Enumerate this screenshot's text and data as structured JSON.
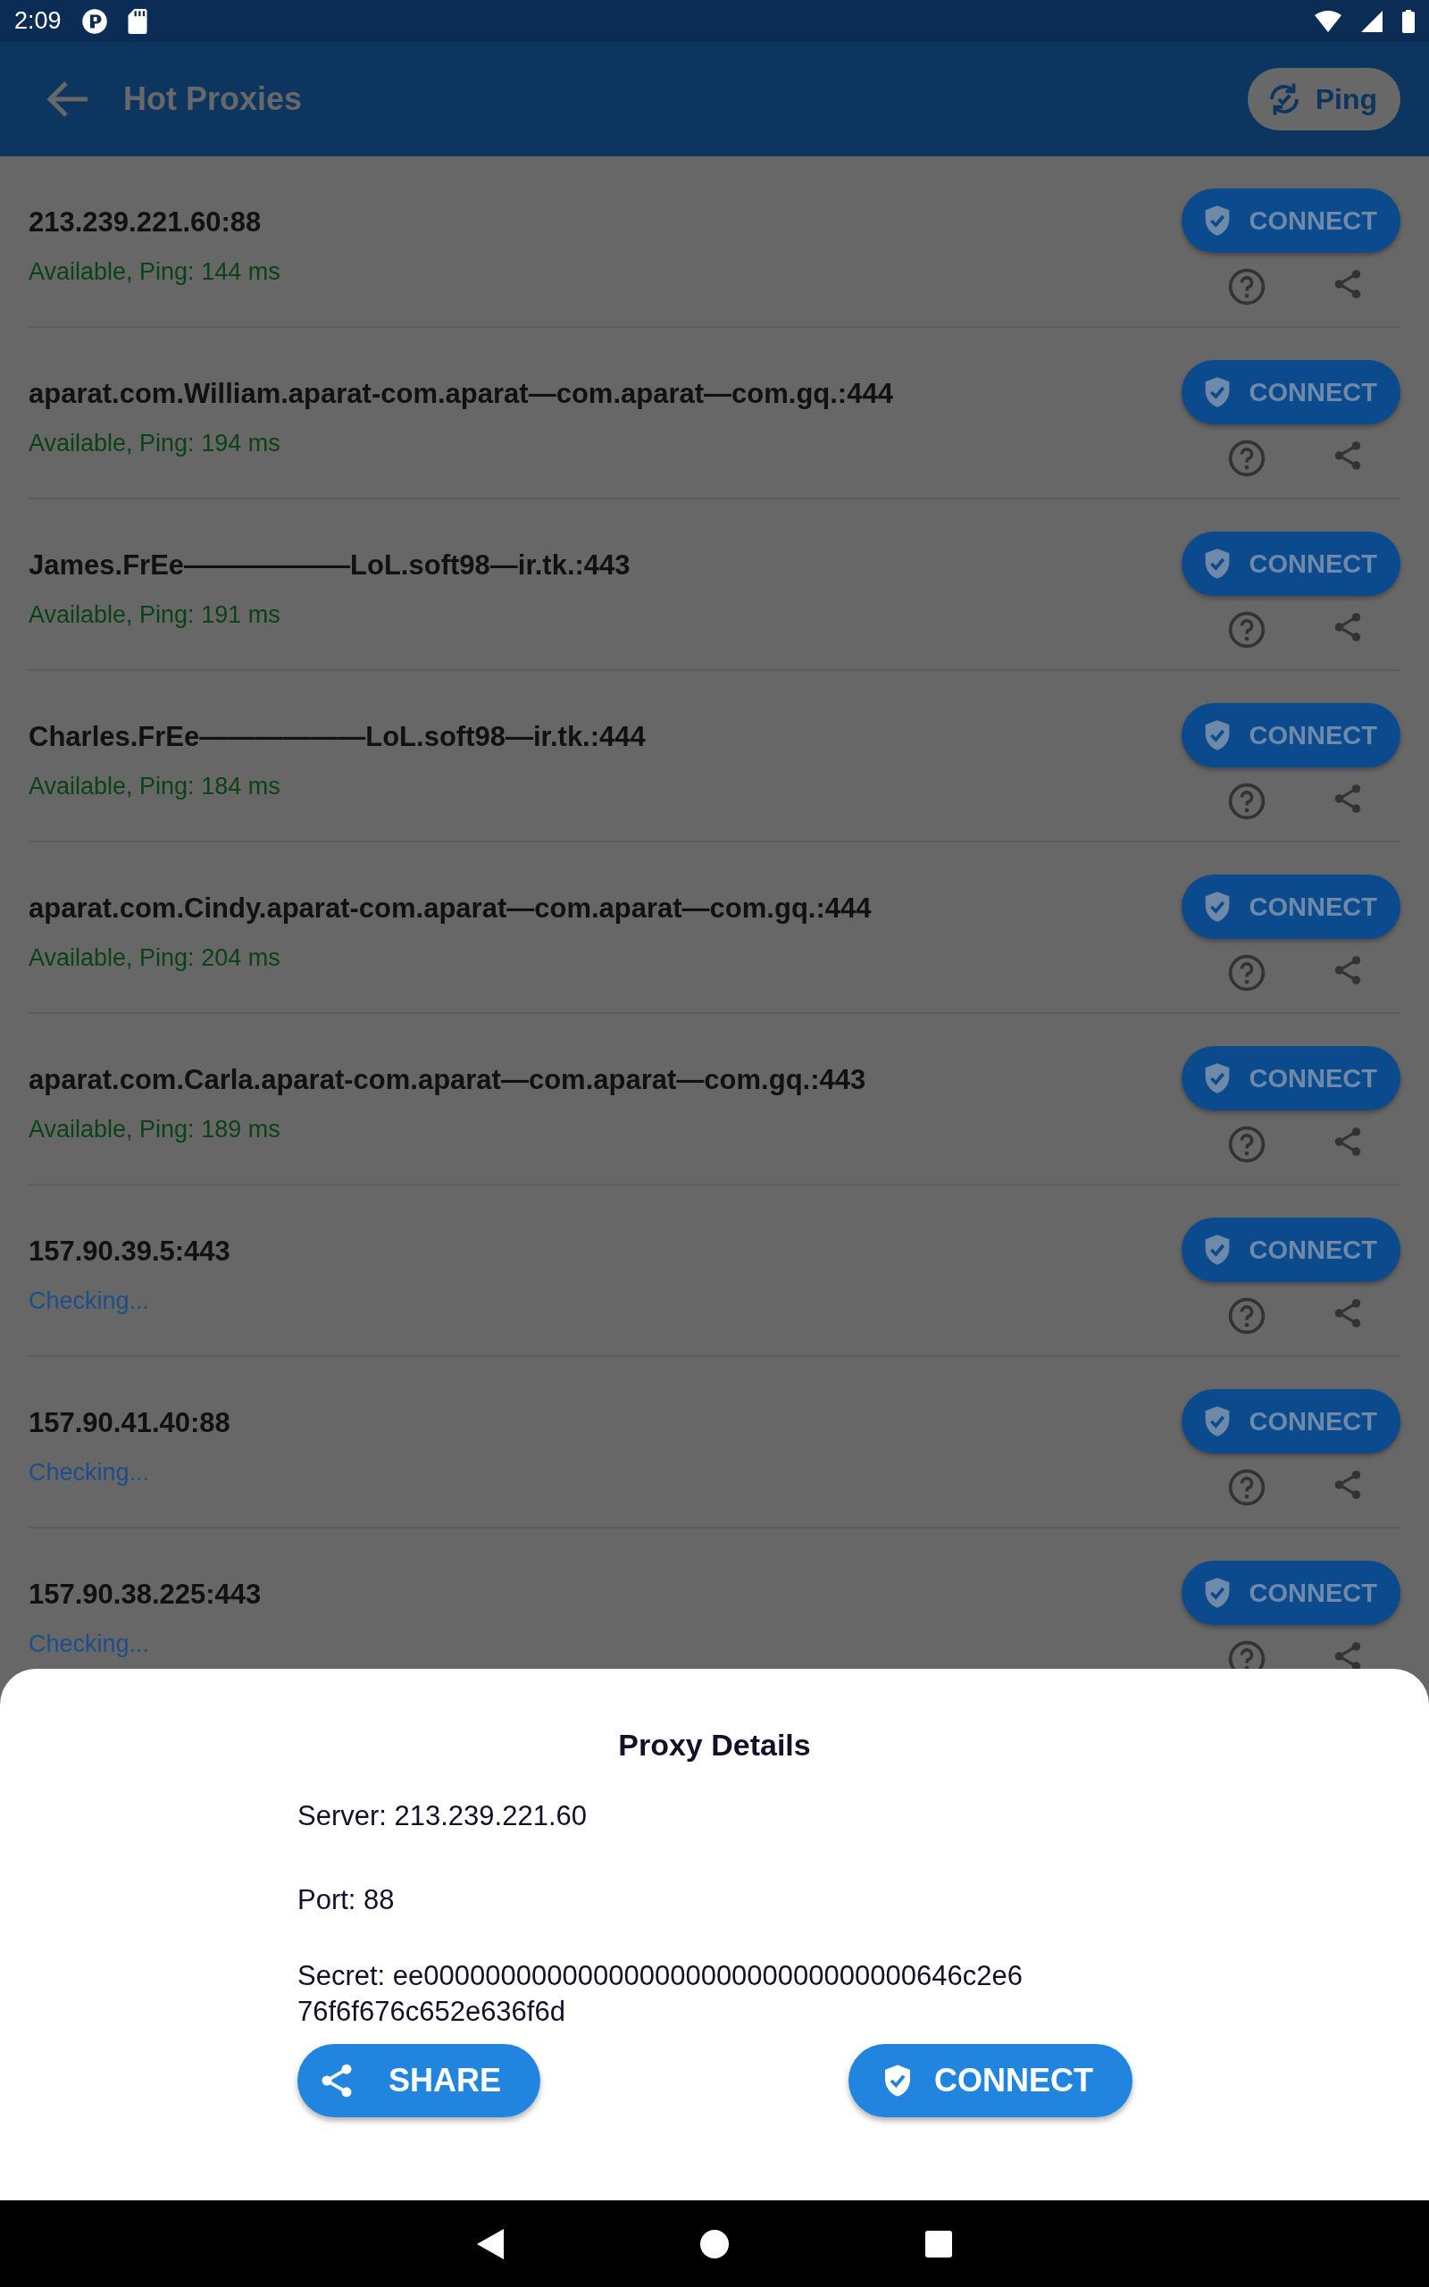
{
  "status_bar": {
    "time": "2:09"
  },
  "app_bar": {
    "title": "Hot Proxies",
    "ping_button": "Ping"
  },
  "proxies": [
    {
      "address": "213.239.221.60:88",
      "status": "Available, Ping: 144 ms",
      "kind": "available",
      "connect": "CONNECT"
    },
    {
      "address": "aparat.com.William.aparat-com.aparat—com.aparat—com.gq.:444",
      "status": "Available, Ping: 194 ms",
      "kind": "available",
      "connect": "CONNECT"
    },
    {
      "address": "James.FrEe——————LoL.soft98—ir.tk.:443",
      "status": "Available, Ping: 191 ms",
      "kind": "available",
      "connect": "CONNECT"
    },
    {
      "address": "Charles.FrEe——————LoL.soft98—ir.tk.:444",
      "status": "Available, Ping: 184 ms",
      "kind": "available",
      "connect": "CONNECT"
    },
    {
      "address": "aparat.com.Cindy.aparat-com.aparat—com.aparat—com.gq.:444",
      "status": "Available, Ping: 204 ms",
      "kind": "available",
      "connect": "CONNECT"
    },
    {
      "address": "aparat.com.Carla.aparat-com.aparat—com.aparat—com.gq.:443",
      "status": "Available, Ping: 189 ms",
      "kind": "available",
      "connect": "CONNECT"
    },
    {
      "address": "157.90.39.5:443",
      "status": "Checking...",
      "kind": "checking",
      "connect": "CONNECT"
    },
    {
      "address": "157.90.41.40:88",
      "status": "Checking...",
      "kind": "checking",
      "connect": "CONNECT"
    },
    {
      "address": "157.90.38.225:443",
      "status": "Checking...",
      "kind": "checking",
      "connect": "CONNECT"
    }
  ],
  "details_sheet": {
    "title": "Proxy Details",
    "server": "Server: 213.239.221.60",
    "port": "Port: 88",
    "secret": "Secret: ee00000000000000000000000000000000646c2e676f6f676c652e636f6d",
    "share_button": "SHARE",
    "connect_button": "CONNECT"
  }
}
